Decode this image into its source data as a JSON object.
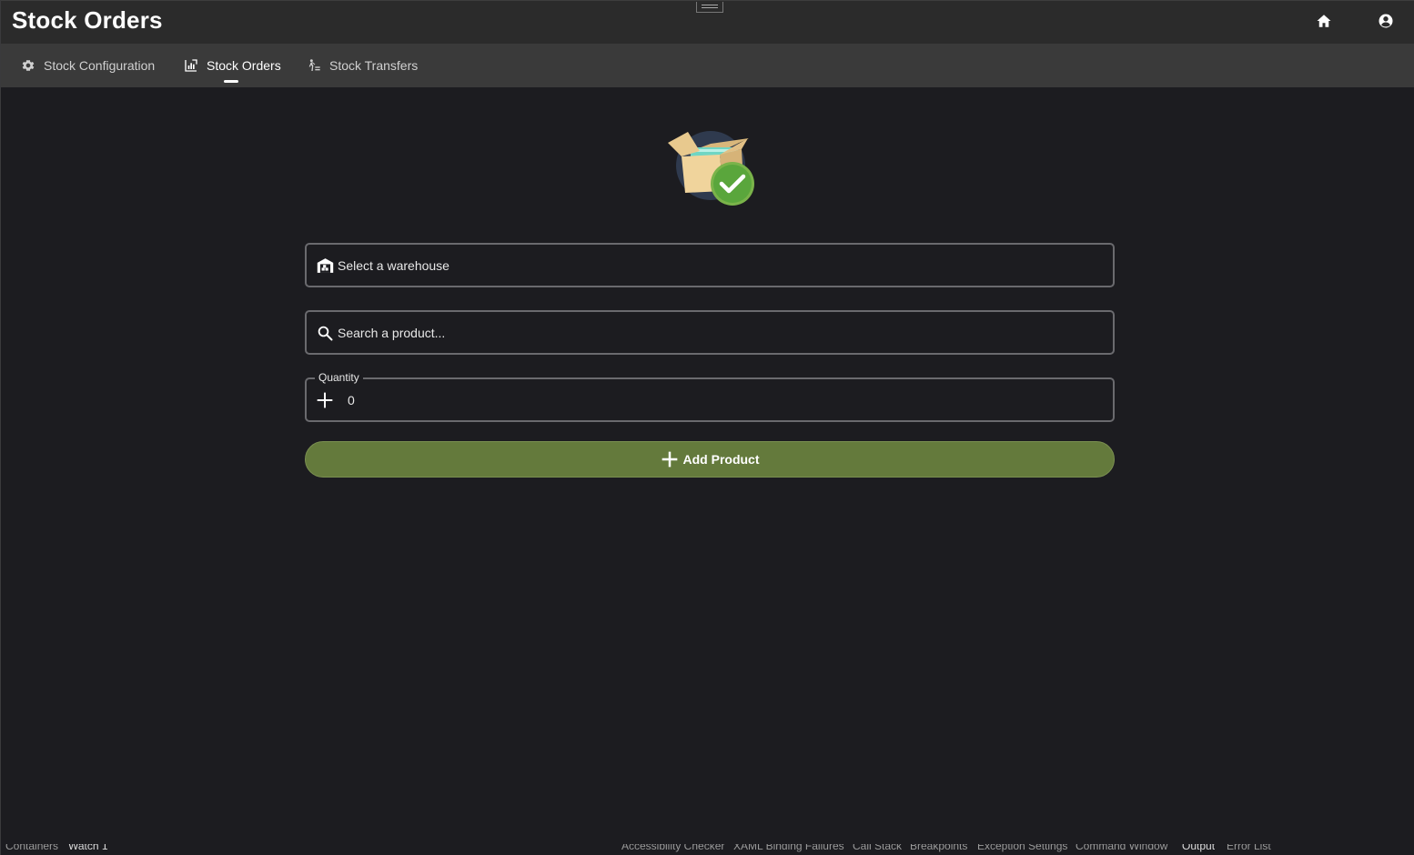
{
  "app": {
    "title": "Stock Orders"
  },
  "header": {
    "icons": [
      "home-icon",
      "account-icon"
    ]
  },
  "tabs": [
    {
      "label": "Stock Configuration",
      "icon": "gear-icon",
      "active": false
    },
    {
      "label": "Stock Orders",
      "icon": "chart-icon",
      "active": true
    },
    {
      "label": "Stock Transfers",
      "icon": "transfer-icon",
      "active": false
    }
  ],
  "form": {
    "warehouse": {
      "placeholder": "Select a warehouse",
      "icon": "warehouse-icon"
    },
    "product": {
      "placeholder": "Search a product...",
      "icon": "search-icon"
    },
    "quantity": {
      "label": "Quantity",
      "value": "0",
      "icon": "plus-icon"
    },
    "add_button": {
      "label": "Add Product",
      "icon": "plus-icon"
    }
  },
  "hero_image": {
    "icon": "box-check-icon"
  },
  "statusbar": {
    "left_tabs": [
      "Containers",
      "Watch 1"
    ],
    "right_tabs": [
      "Accessibility Checker",
      "XAML Binding Failures",
      "Call Stack",
      "Breakpoints",
      "Exception Settings",
      "Command Window",
      "Output",
      "Error List"
    ]
  },
  "colors": {
    "background": "#1c1c20",
    "titlebar": "#2b2b2b",
    "tabbar": "#3a3a3a",
    "accent_button": "#647a3c",
    "check_green": "#5aa63c"
  }
}
